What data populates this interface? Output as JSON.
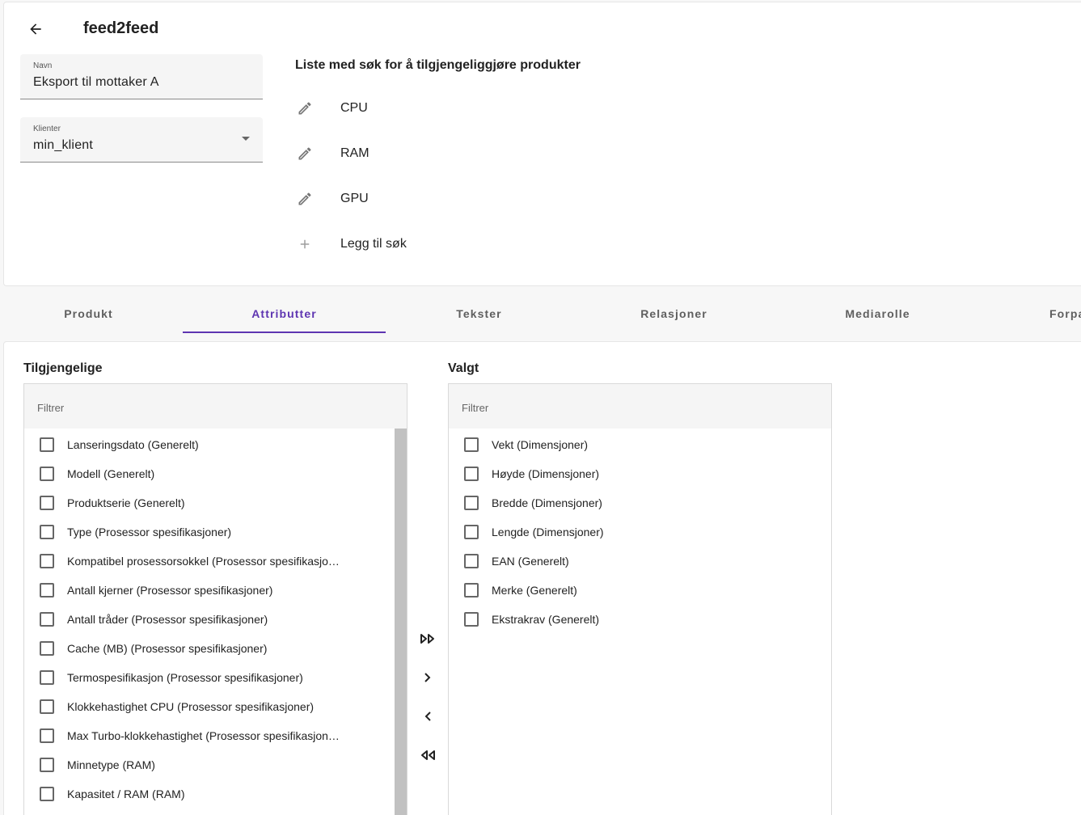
{
  "header": {
    "title": "feed2feed"
  },
  "form": {
    "name_label": "Navn",
    "name_value": "Eksport til mottaker A",
    "client_label": "Klienter",
    "client_value": "min_klient"
  },
  "search_list": {
    "title": "Liste med søk for å tilgjengeliggjøre produkter",
    "items": [
      "CPU",
      "RAM",
      "GPU"
    ],
    "add_label": "Legg til søk"
  },
  "tabs": [
    "Produkt",
    "Attributter",
    "Tekster",
    "Relasjoner",
    "Mediarolle",
    "Forpa"
  ],
  "active_tab": "Attributter",
  "available": {
    "title": "Tilgjengelige",
    "filter_placeholder": "Filtrer",
    "items": [
      "Lanseringsdato (Generelt)",
      "Modell (Generelt)",
      "Produktserie (Generelt)",
      "Type (Prosessor spesifikasjoner)",
      "Kompatibel prosessorsokkel (Prosessor spesifikasjo…",
      "Antall kjerner (Prosessor spesifikasjoner)",
      "Antall tråder (Prosessor spesifikasjoner)",
      "Cache (MB) (Prosessor spesifikasjoner)",
      "Termospesifikasjon (Prosessor spesifikasjoner)",
      "Klokkehastighet CPU (Prosessor spesifikasjoner)",
      "Max Turbo-klokkehastighet (Prosessor spesifikasjon…",
      "Minnetype (RAM)",
      "Kapasitet / RAM (RAM)"
    ]
  },
  "selected": {
    "title": "Valgt",
    "filter_placeholder": "Filtrer",
    "items": [
      "Vekt (Dimensjoner)",
      "Høyde (Dimensjoner)",
      "Bredde (Dimensjoner)",
      "Lengde (Dimensjoner)",
      "EAN (Generelt)",
      "Merke (Generelt)",
      "Ekstrakrav (Generelt)"
    ]
  },
  "colors": {
    "accent": "#5e35b1",
    "text": "#222222",
    "muted": "#5f5f5f"
  },
  "icons": {
    "back": "arrow-left-icon",
    "edit": "pencil-icon",
    "add": "plus-icon",
    "move_all_right": "double-chevron-right-icon",
    "move_right": "chevron-right-icon",
    "move_left": "chevron-left-icon",
    "move_all_left": "double-chevron-left-icon"
  }
}
